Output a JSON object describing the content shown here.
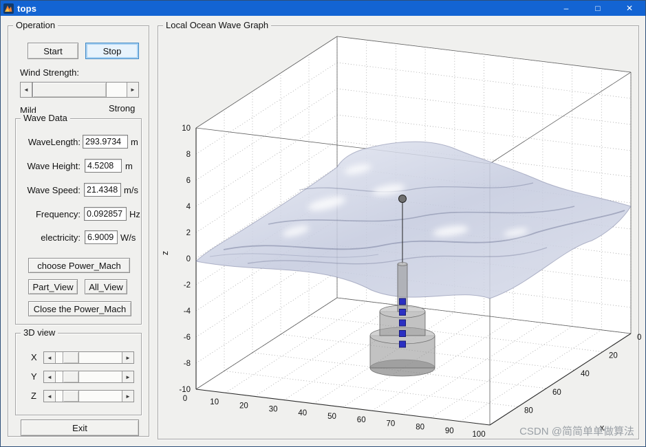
{
  "window": {
    "title": "tops",
    "minimize_icon": "–",
    "maximize_icon": "□",
    "close_icon": "✕"
  },
  "icons": {
    "arrow_left": "◄",
    "arrow_right": "►"
  },
  "operation": {
    "title": "Operation",
    "start": "Start",
    "stop": "Stop",
    "wind_strength": "Wind Strength:",
    "mild": "Mild",
    "strong": "Strong"
  },
  "wave_data": {
    "title": "Wave Data",
    "fields": [
      {
        "label": "WaveLength:",
        "value": "293.9734",
        "unit": "m"
      },
      {
        "label": "Wave Height:",
        "value": "4.5208",
        "unit": "m"
      },
      {
        "label": "Wave Speed:",
        "value": "21.4348",
        "unit": "m/s"
      },
      {
        "label": "Frequency:",
        "value": "0.092857",
        "unit": "Hz"
      },
      {
        "label": "electricity:",
        "value": "6.9009",
        "unit": "W/s"
      }
    ],
    "choose_power_mach": "choose Power_Mach",
    "part_view": "Part_View",
    "all_view": "All_View",
    "close_power_mach": "Close the Power_Mach"
  },
  "view3d": {
    "title": "3D view",
    "x_label": "X",
    "y_label": "Y",
    "z_label": "Z"
  },
  "exit_label": "Exit",
  "plot": {
    "title": "Local Ocean Wave Graph",
    "z_axis_label": "z",
    "x_label": "x",
    "z_ticks": [
      "10",
      "8",
      "6",
      "4",
      "2",
      "0",
      "-2",
      "-4",
      "-6",
      "-8",
      "-10"
    ],
    "x_ticks": [
      "0",
      "10",
      "20",
      "30",
      "40",
      "50",
      "60",
      "70",
      "80",
      "90",
      "100"
    ],
    "y_ticks": [
      "0",
      "20",
      "40",
      "60",
      "80"
    ],
    "watermark": "CSDN @简简单单做算法"
  }
}
